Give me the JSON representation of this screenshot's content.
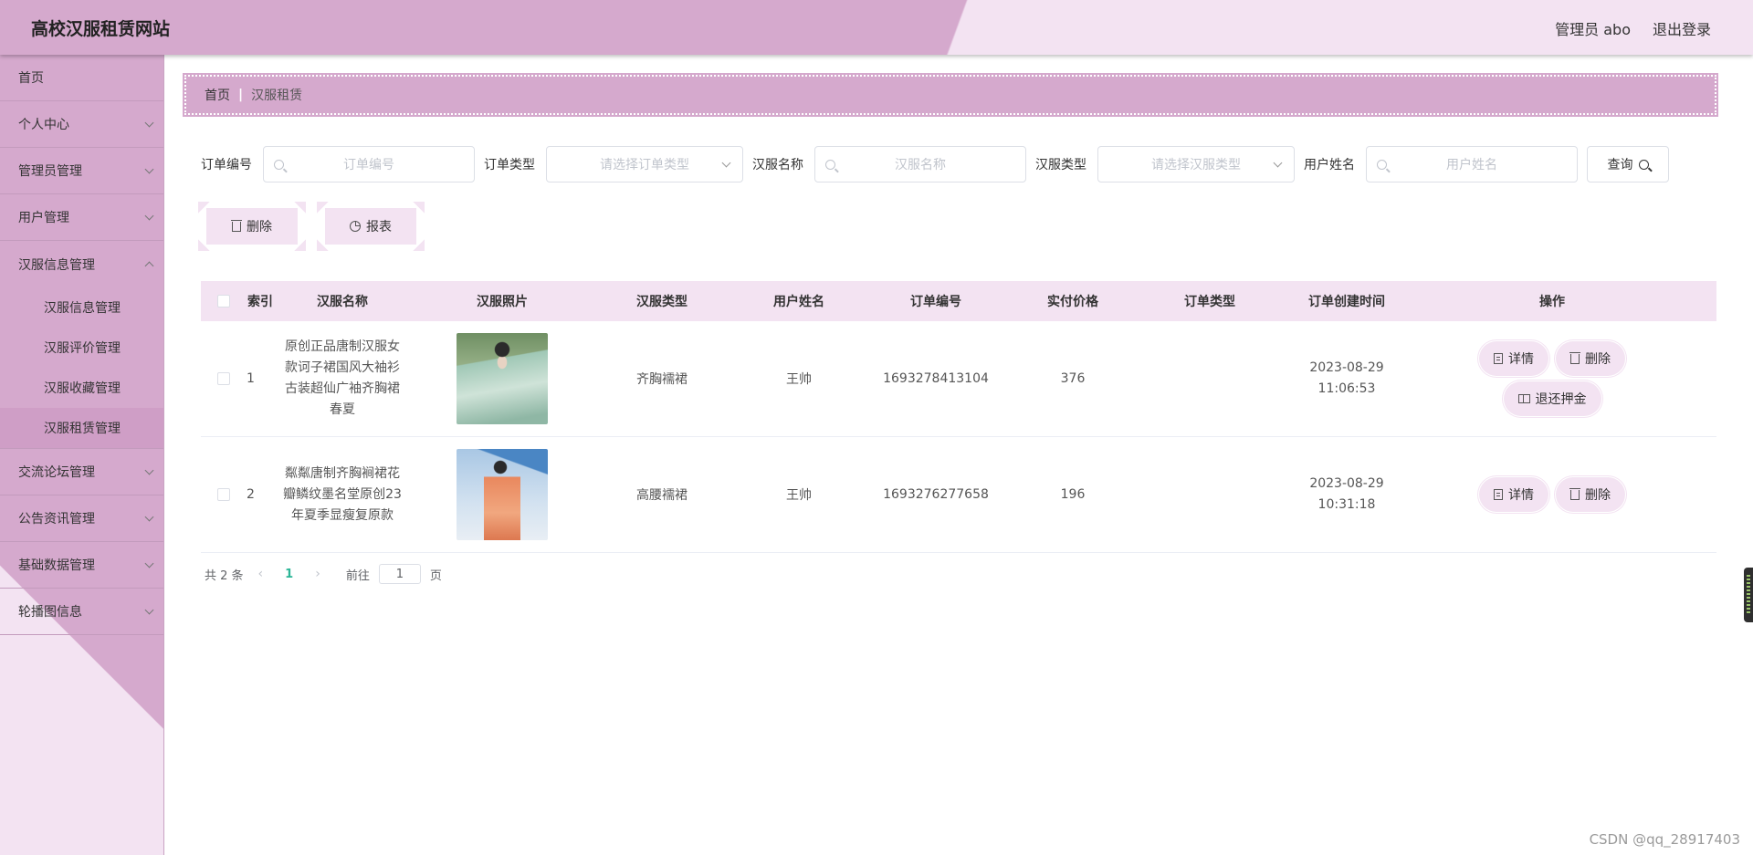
{
  "header": {
    "app_title": "高校汉服租赁网站",
    "user_label": "管理员 abo",
    "logout_label": "退出登录"
  },
  "sidebar": {
    "items": [
      {
        "label": "首页",
        "has_children": false
      },
      {
        "label": "个人中心",
        "has_children": true
      },
      {
        "label": "管理员管理",
        "has_children": true
      },
      {
        "label": "用户管理",
        "has_children": true
      },
      {
        "label": "汉服信息管理",
        "has_children": true,
        "open": true,
        "children": [
          "汉服信息管理",
          "汉服评价管理",
          "汉服收藏管理",
          "汉服租赁管理"
        ],
        "active_child": "汉服租赁管理"
      },
      {
        "label": "交流论坛管理",
        "has_children": true
      },
      {
        "label": "公告资讯管理",
        "has_children": true
      },
      {
        "label": "基础数据管理",
        "has_children": true
      },
      {
        "label": "轮播图信息",
        "has_children": true
      }
    ]
  },
  "breadcrumb": {
    "home": "首页",
    "separator": "|",
    "current": "汉服租赁"
  },
  "search": {
    "order_no_label": "订单编号",
    "order_no_placeholder": "订单编号",
    "order_type_label": "订单类型",
    "order_type_placeholder": "请选择订单类型",
    "hanfu_name_label": "汉服名称",
    "hanfu_name_placeholder": "汉服名称",
    "hanfu_type_label": "汉服类型",
    "hanfu_type_placeholder": "请选择汉服类型",
    "user_name_label": "用户姓名",
    "user_name_placeholder": "用户姓名",
    "query_label": "查询"
  },
  "actions": {
    "delete_label": "删除",
    "report_label": "报表"
  },
  "table": {
    "headers": [
      "索引",
      "汉服名称",
      "汉服照片",
      "汉服类型",
      "用户姓名",
      "订单编号",
      "实付价格",
      "订单类型",
      "订单创建时间",
      "操作"
    ],
    "rows": [
      {
        "index": "1",
        "name": "原创正品唐制汉服女款诃子裙国风大袖衫古装超仙广袖齐胸裙春夏",
        "type": "齐胸襦裙",
        "user": "王帅",
        "order_no": "1693278413104",
        "price": "376",
        "order_type": "",
        "created": "2023-08-29 11:06:53",
        "ops": [
          "详情",
          "删除",
          "退还押金"
        ]
      },
      {
        "index": "2",
        "name": "粼粼唐制齐胸裥裙花瓣鳞纹墨名堂原创23年夏季显瘦复原款",
        "type": "高腰襦裙",
        "user": "王帅",
        "order_no": "1693276277658",
        "price": "196",
        "order_type": "",
        "created": "2023-08-29 10:31:18",
        "ops": [
          "详情",
          "删除"
        ]
      }
    ]
  },
  "pagination": {
    "total_text": "共 2 条",
    "prev": "‹",
    "current_page": "1",
    "next": "›",
    "goto_label": "前往",
    "goto_value": "1",
    "page_suffix": "页"
  },
  "watermark": "CSDN @qq_28917403",
  "colors": {
    "primary_pink": "#d5a9cd",
    "light_pink": "#f3e3f2",
    "active_page": "#2bb596"
  }
}
